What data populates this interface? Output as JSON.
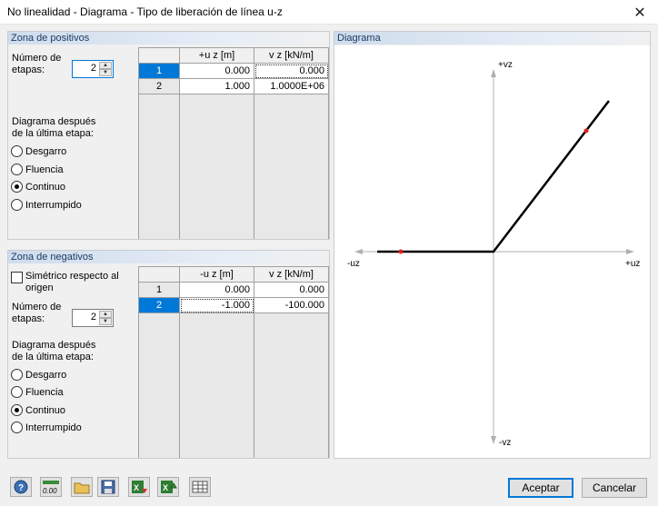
{
  "window": {
    "title": "No linealidad - Diagrama - Tipo de liberación de línea u-z",
    "close_glyph": "✕"
  },
  "positive": {
    "title": "Zona de positivos",
    "stages_label_1": "Número de",
    "stages_label_2": "etapas:",
    "stages_value": "2",
    "after_label_1": "Diagrama después",
    "after_label_2": "de la última etapa:",
    "options": [
      "Desgarro",
      "Fluencia",
      "Continuo",
      "Interrumpido"
    ],
    "selected": "Continuo",
    "col1": "+u z [m]",
    "col2": "v z [kN/m]",
    "rows": [
      {
        "n": "1",
        "u": "0.000",
        "v": "0.000"
      },
      {
        "n": "2",
        "u": "1.000",
        "v": "1.0000E+06"
      }
    ]
  },
  "negative": {
    "title": "Zona de negativos",
    "symmetric_1": "Simétrico respecto al",
    "symmetric_2": "origen",
    "stages_label_1": "Número de",
    "stages_label_2": "etapas:",
    "stages_value": "2",
    "after_label_1": "Diagrama después",
    "after_label_2": "de la última etapa:",
    "options": [
      "Desgarro",
      "Fluencia",
      "Continuo",
      "Interrumpido"
    ],
    "selected": "Continuo",
    "col1": "-u z [m]",
    "col2": "v z [kN/m]",
    "rows": [
      {
        "n": "1",
        "u": "0.000",
        "v": "0.000"
      },
      {
        "n": "2",
        "u": "-1.000",
        "v": "-100.000"
      }
    ]
  },
  "diagram": {
    "title": "Diagrama",
    "label_top": "+vz",
    "label_bottom": "-vz",
    "label_left": "-uz",
    "label_right": "+uz",
    "curve_color": "#000000",
    "point_color": "#e02020"
  },
  "footer": {
    "ok": "Aceptar",
    "cancel": "Cancelar",
    "number_format": "0.00",
    "tools": [
      "help-icon",
      "decimal-places-icon",
      "open-folder-icon",
      "save-icon",
      "import-excel-icon",
      "export-excel-icon",
      "table-icon"
    ]
  }
}
